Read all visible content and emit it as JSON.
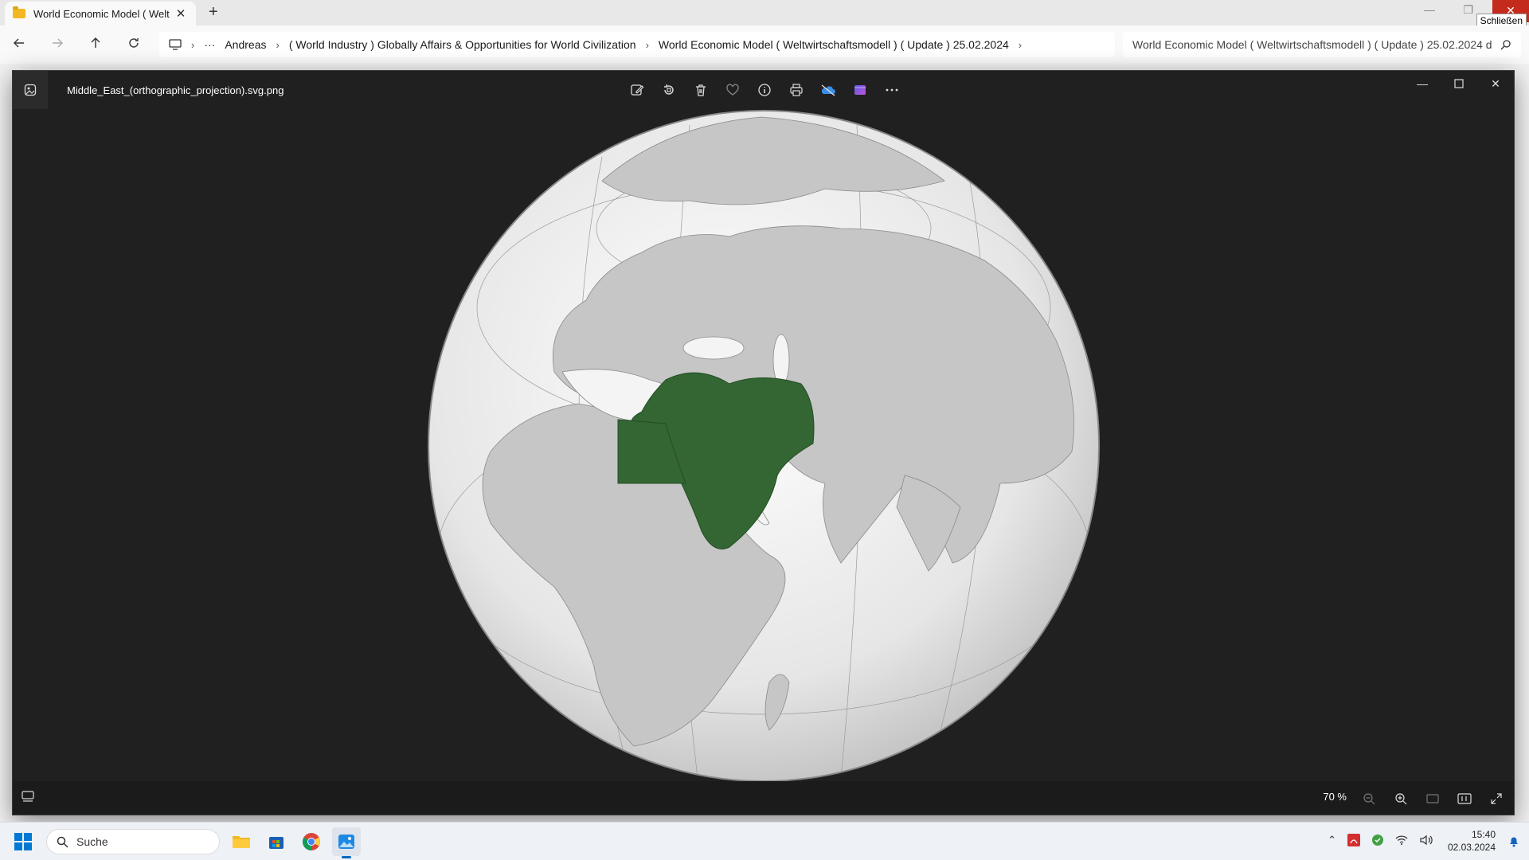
{
  "explorer": {
    "tab_title": "World Economic Model ( Welt",
    "tab_close": "✕",
    "new_tab": "+",
    "close_tooltip": "Schließen",
    "breadcrumb": {
      "more": "···",
      "items": [
        "Andreas",
        "( World Industry ) Globally Affairs & Opportunities for World Civilization",
        "World Economic Model ( Weltwirtschaftsmodell ) ( Update ) 25.02.2024"
      ]
    },
    "search_value": "World Economic Model ( Weltwirtschaftsmodell ) ( Update ) 25.02.2024 d"
  },
  "viewer": {
    "filename": "Middle_East_(orthographic_projection).svg.png",
    "toolbar_icons": [
      "edit-icon",
      "rotate-icon",
      "delete-icon",
      "favorite-icon",
      "info-icon",
      "print-icon",
      "onedrive-icon",
      "clipchamp-icon",
      "more-icon"
    ],
    "zoom": "70 %",
    "highlight_color": "#336633",
    "land_color": "#c8c8c8",
    "globe_color": "#ececec"
  },
  "taskbar": {
    "search_placeholder": "Suche",
    "time": "15:40",
    "date": "02.03.2024"
  }
}
